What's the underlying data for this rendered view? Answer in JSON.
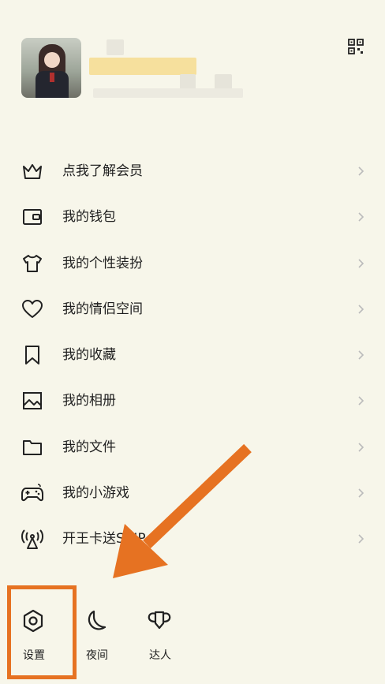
{
  "profile": {
    "avatar_icon": "anime-girl-avatar",
    "qr_icon": "qr-code-icon"
  },
  "menu": [
    {
      "label": "点我了解会员",
      "icon": "crown-icon"
    },
    {
      "label": "我的钱包",
      "icon": "wallet-icon"
    },
    {
      "label": "我的个性装扮",
      "icon": "tshirt-icon"
    },
    {
      "label": "我的情侣空间",
      "icon": "heart-icon"
    },
    {
      "label": "我的收藏",
      "icon": "bookmark-icon"
    },
    {
      "label": "我的相册",
      "icon": "photo-album-icon"
    },
    {
      "label": "我的文件",
      "icon": "folder-icon"
    },
    {
      "label": "我的小游戏",
      "icon": "gamepad-icon"
    },
    {
      "label": "开王卡送SVIP",
      "icon": "signal-tower-icon"
    }
  ],
  "bottom": {
    "settings_label": "设置",
    "night_label": "夜间",
    "expert_label": "达人"
  },
  "colors": {
    "background": "#f7f6ea",
    "highlight": "#e67222",
    "blurred_name": "#f6dc8f"
  }
}
